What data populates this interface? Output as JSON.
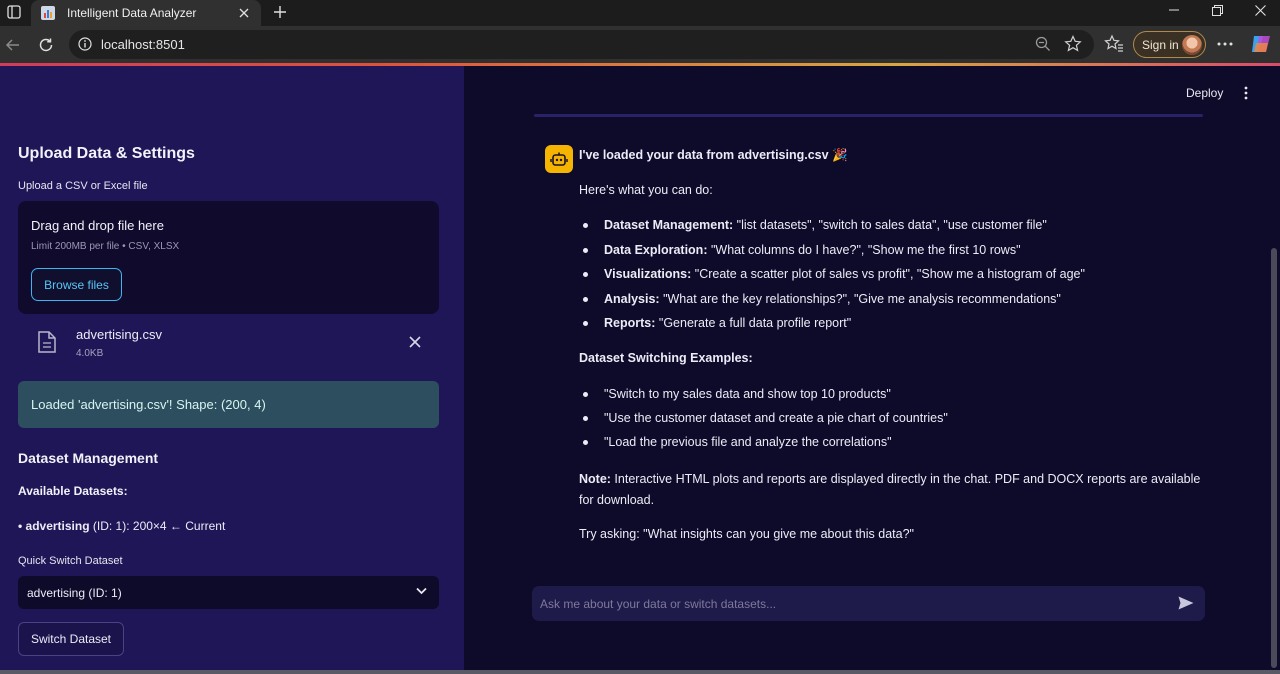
{
  "browser": {
    "tab_title": "Intelligent Data Analyzer",
    "url": "localhost:8501",
    "signin_label": "Sign in"
  },
  "sidebar": {
    "title": "Upload Data & Settings",
    "upload_label": "Upload a CSV or Excel file",
    "dropzone_title": "Drag and drop file here",
    "dropzone_limit": "Limit 200MB per file • CSV, XLSX",
    "browse_label": "Browse files",
    "file": {
      "name": "advertising.csv",
      "size": "4.0KB"
    },
    "success_message": "Loaded 'advertising.csv'! Shape: (200, 4)",
    "dataset_mgmt_title": "Dataset Management",
    "available_label": "Available Datasets:",
    "dataset_item_bold": "• advertising",
    "dataset_item_rest": " (ID: 1): 200×4 ← Current",
    "quick_switch_label": "Quick Switch Dataset",
    "select_value": "advertising (ID: 1)",
    "switch_button": "Switch Dataset"
  },
  "header": {
    "deploy_label": "Deploy"
  },
  "message": {
    "title": "I've loaded your data from advertising.csv 🎉",
    "intro": "Here's what you can do:",
    "capabilities": [
      {
        "label": "Dataset Management:",
        "text": " \"list datasets\", \"switch to sales data\", \"use customer file\""
      },
      {
        "label": "Data Exploration:",
        "text": " \"What columns do I have?\", \"Show me the first 10 rows\""
      },
      {
        "label": "Visualizations:",
        "text": " \"Create a scatter plot of sales vs profit\", \"Show me a histogram of age\""
      },
      {
        "label": "Analysis:",
        "text": " \"What are the key relationships?\", \"Give me analysis recommendations\""
      },
      {
        "label": "Reports:",
        "text": " \"Generate a full data profile report\""
      }
    ],
    "switching_title": "Dataset Switching Examples:",
    "examples": [
      "\"Switch to my sales data and show top 10 products\"",
      "\"Use the customer dataset and create a pie chart of countries\"",
      "\"Load the previous file and analyze the correlations\""
    ],
    "note_label": "Note:",
    "note_text": " Interactive HTML plots and reports are displayed directly in the chat. PDF and DOCX reports are available for download.",
    "try_text": "Try asking: \"What insights can you give me about this data?\""
  },
  "chat_input": {
    "placeholder": "Ask me about your data or switch datasets..."
  },
  "colors": {
    "sidebar_bg": "#1e1657",
    "main_bg": "#0e0a2a",
    "accent_blue": "#3fb4f0",
    "success_bg": "#2c4e5e",
    "avatar_yellow": "#f4b400"
  }
}
